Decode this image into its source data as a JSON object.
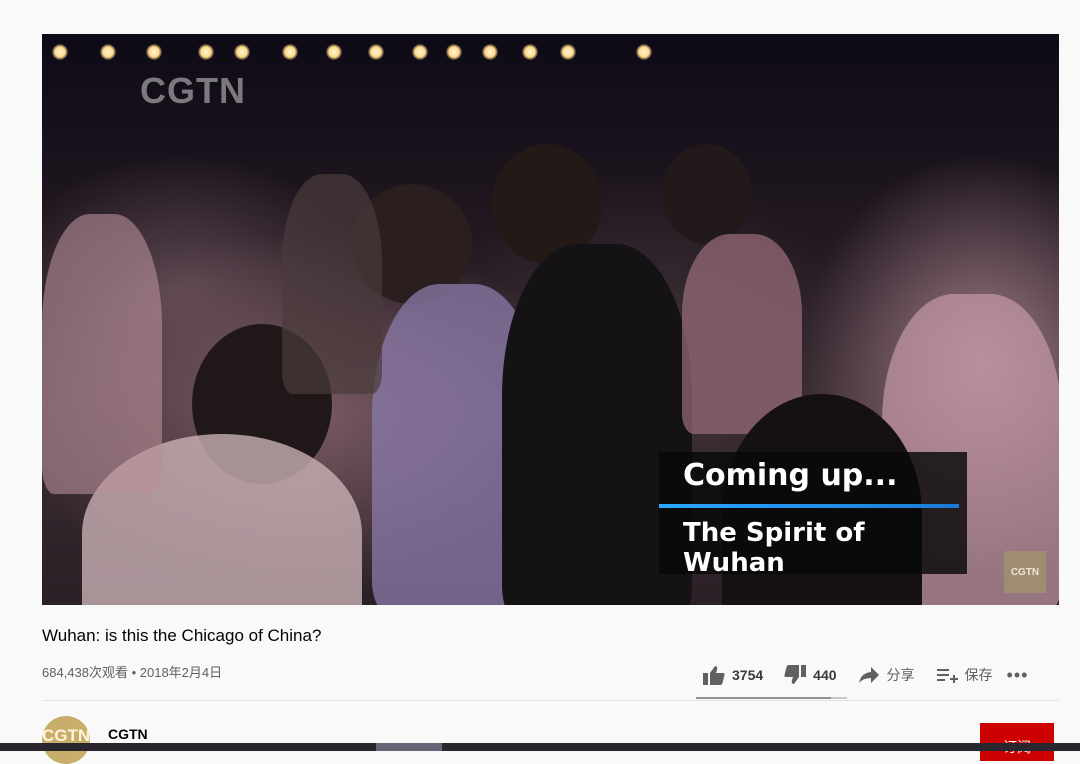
{
  "video": {
    "watermark_top": "CGTN",
    "lower_third_heading": "Coming up...",
    "lower_third_subheading": "The Spirit of Wuhan",
    "watermark_corner": "CGTN"
  },
  "info": {
    "title": "Wuhan: is this the Chicago of China?",
    "meta": "684,438次观看 • 2018年2月4日"
  },
  "actions": {
    "likes": "3754",
    "dislikes": "440",
    "share_label": "分享",
    "save_label": "保存",
    "more_label": "•••",
    "like_ratio": 0.895
  },
  "channel": {
    "avatar_text": "CGTN",
    "name": "CGTN",
    "subscribe_label": "订阅"
  },
  "colors": {
    "subscribe_bg": "#cc0000",
    "lower_third_bar": "#2aa7ff",
    "avatar_bg": "#c9ad6b"
  }
}
